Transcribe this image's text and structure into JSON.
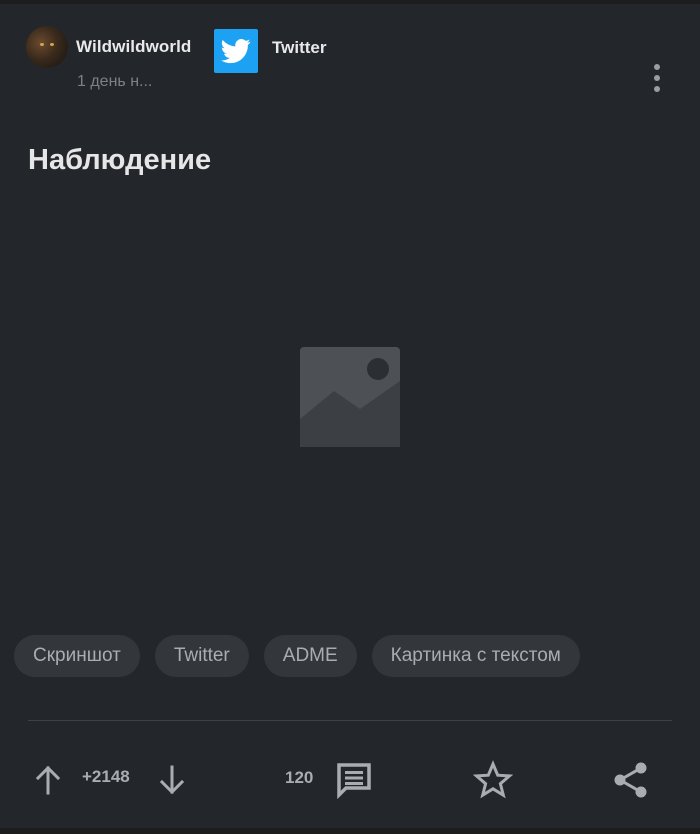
{
  "post": {
    "author": "Wildwildworld",
    "time": "1 день н...",
    "community": "Twitter",
    "title": "Наблюдение"
  },
  "tags": [
    "Скриншот",
    "Twitter",
    "ADME",
    "Картинка с текстом"
  ],
  "footer": {
    "rating": "+2148",
    "comments": "120"
  },
  "icons": {
    "community": "twitter-bird-icon",
    "more": "more-vertical-icon",
    "placeholder": "image-placeholder-icon",
    "upvote": "arrow-up-icon",
    "downvote": "arrow-down-icon",
    "comments": "comment-icon",
    "save": "star-icon",
    "share": "share-icon"
  },
  "colors": {
    "background": "#23272b",
    "twitter": "#1da1f2",
    "text": "#e6e6e6",
    "muted": "#a9adb2"
  }
}
